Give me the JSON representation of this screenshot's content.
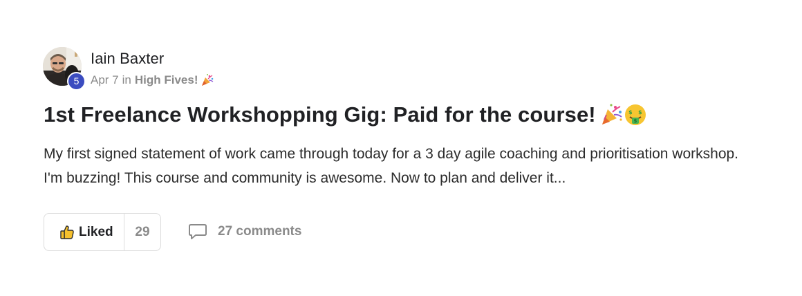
{
  "post": {
    "author": {
      "name": "Iain Baxter",
      "level": "5"
    },
    "meta": {
      "date": "Apr 7",
      "in_label": "in",
      "category": "High Fives!"
    },
    "title": "1st Freelance Workshopping Gig: Paid for the course!",
    "body": "My first signed statement of work came through today for a 3 day agile coaching and prioritisation workshop. I'm buzzing! This course and community is awesome. Now to plan and deliver it...",
    "actions": {
      "like_label": "Liked",
      "like_count": "29",
      "comments_label": "27 comments"
    },
    "icons": {
      "avatar": "avatar-photo",
      "category_emoji": "party-popper-icon",
      "title_emojis": [
        "party-popper-icon",
        "money-mouth-face-icon"
      ],
      "like": "thumbs-up-icon",
      "comments": "speech-bubble-icon"
    },
    "colors": {
      "level_badge": "#3b4cc0",
      "text_primary": "#202124",
      "text_muted": "#8a8a8a",
      "border": "#dcdcdc"
    }
  }
}
